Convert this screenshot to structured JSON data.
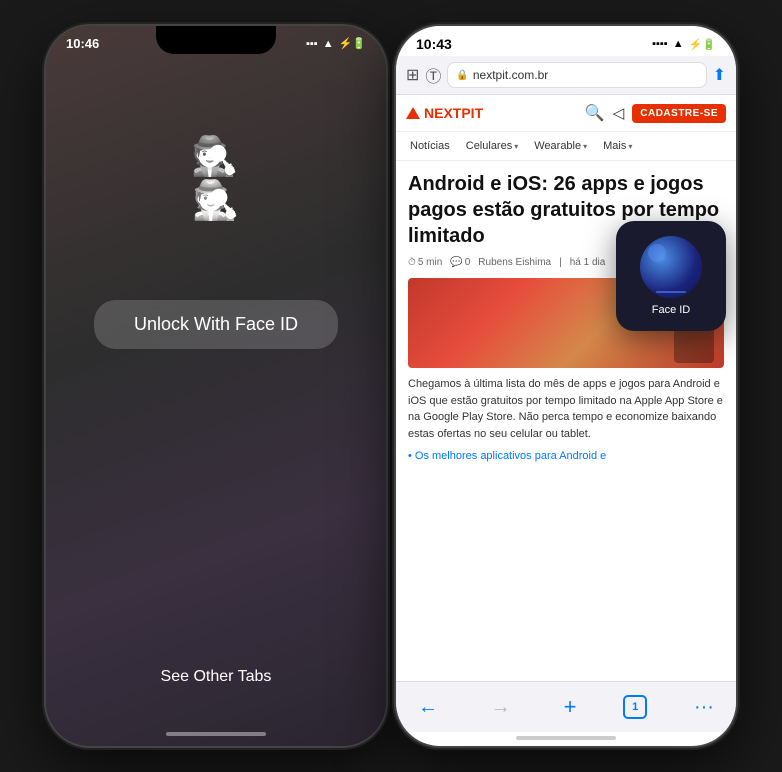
{
  "left_phone": {
    "status_bar": {
      "time": "10:46",
      "signal": "●●●",
      "wifi": "wifi",
      "battery": "⚡"
    },
    "incognito_emoji": "🕵️",
    "unlock_button_label": "Unlock With Face ID",
    "see_other_tabs_label": "See Other Tabs"
  },
  "right_phone": {
    "status_bar": {
      "time": "10:43",
      "signal": "●●●●",
      "wifi": "wifi",
      "battery": "⚡"
    },
    "browser": {
      "toolbar_icons": [
        "extensions",
        "translate"
      ],
      "address": "nextpit.com.br",
      "lock": "🔒",
      "share_icon": "⬆"
    },
    "nextpit": {
      "logo_text": "NEXTPIT",
      "search_icon": "🔍",
      "share_icon": "share",
      "cadastre_label": "CADASTRE-SE",
      "nav_items": [
        {
          "label": "Notícias",
          "has_dropdown": false
        },
        {
          "label": "Celulares",
          "has_dropdown": true
        },
        {
          "label": "Wearable",
          "has_dropdown": true
        },
        {
          "label": "Mais",
          "has_dropdown": true
        }
      ]
    },
    "article": {
      "title": "Android e iOS: 26 apps e jogos pagos estão gratuitos por tempo limitado",
      "read_time": "5 min",
      "comments": "0",
      "author": "Rubens Eishima",
      "date": "há 1 dia",
      "body": "Chegamos à última lista do mês de apps e jogos para Android e iOS que estão gratuitos por tempo limitado na Apple App Store e na Google Play Store. Não perca tempo e economize baixando estas ofertas no seu celular ou tablet.",
      "link_text": "• Os melhores aplicativos para Android e"
    },
    "face_id_popup": {
      "label": "Face ID"
    },
    "bottom_bar": {
      "back": "←",
      "forward": "→",
      "plus": "+",
      "tabs_count": "1",
      "more": "···"
    }
  }
}
